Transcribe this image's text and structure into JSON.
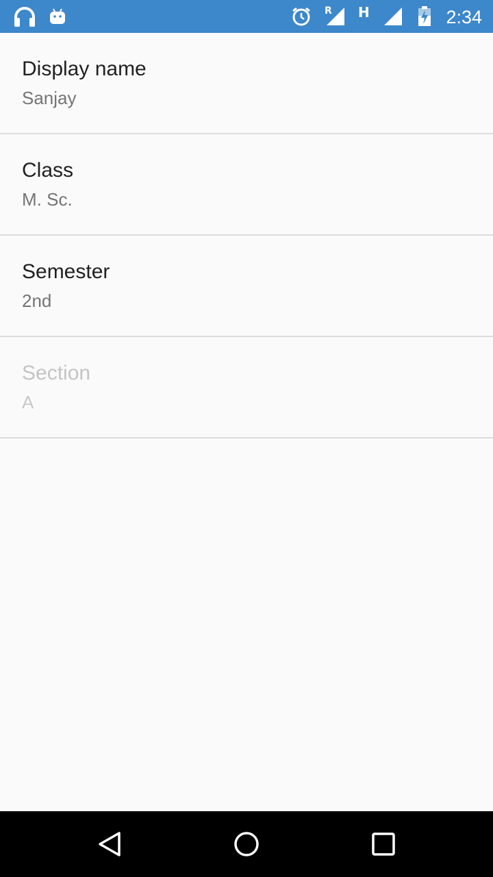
{
  "status_bar": {
    "time": "2:34",
    "roaming_label": "R",
    "network_type": "H",
    "left_icons": [
      "headphones-icon",
      "android-notification-icon"
    ],
    "right_icons": [
      "alarm-icon",
      "signal-roaming-icon",
      "signal-icon",
      "battery-charging-icon"
    ],
    "background_color": "#3d87cb"
  },
  "preferences": [
    {
      "title": "Display name",
      "summary": "Sanjay",
      "enabled": true
    },
    {
      "title": "Class",
      "summary": "M. Sc.",
      "enabled": true
    },
    {
      "title": "Semester",
      "summary": "2nd",
      "enabled": true
    },
    {
      "title": "Section",
      "summary": "A",
      "enabled": false
    }
  ],
  "nav_bar": {
    "buttons": [
      "back-icon",
      "home-icon",
      "recents-icon"
    ]
  }
}
